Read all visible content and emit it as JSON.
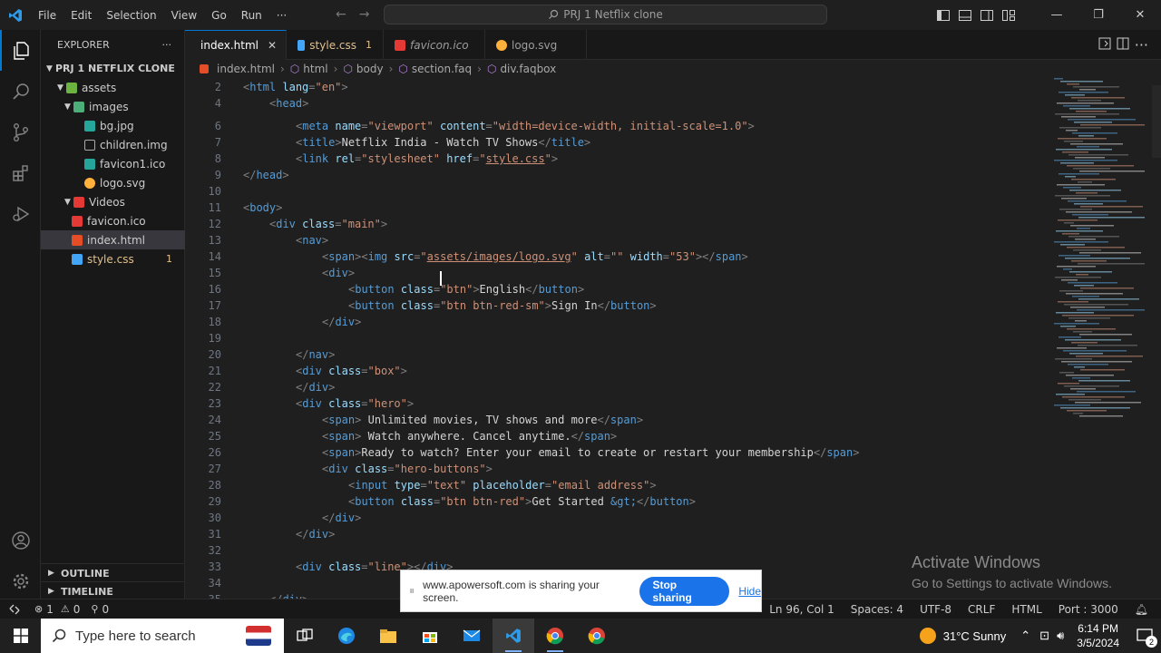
{
  "titlebar": {
    "menu": [
      "File",
      "Edit",
      "Selection",
      "View",
      "Go",
      "Run",
      "···"
    ],
    "search_text": "PRJ 1 Netflix clone"
  },
  "sidebar": {
    "title": "EXPLORER",
    "project": "PRJ 1 NETFLIX CLONE",
    "items": [
      {
        "label": "assets",
        "type": "folder"
      },
      {
        "label": "images",
        "type": "folder"
      },
      {
        "label": "bg.jpg",
        "type": "image"
      },
      {
        "label": "children.img",
        "type": "file"
      },
      {
        "label": "favicon1.ico",
        "type": "image"
      },
      {
        "label": "logo.svg",
        "type": "svg"
      },
      {
        "label": "Videos",
        "type": "folder"
      },
      {
        "label": "favicon.ico",
        "type": "ico"
      },
      {
        "label": "index.html",
        "type": "html"
      },
      {
        "label": "style.css",
        "type": "css",
        "badge": "1"
      }
    ],
    "outline": "OUTLINE",
    "timeline": "TIMELINE"
  },
  "tabs": [
    {
      "label": "index.html",
      "active": true
    },
    {
      "label": "style.css",
      "modified": "1"
    },
    {
      "label": "favicon.ico"
    },
    {
      "label": "logo.svg"
    }
  ],
  "breadcrumb": [
    "index.html",
    "html",
    "body",
    "section.faq",
    "div.faqbox"
  ],
  "editor": {
    "line_numbers": [
      "2",
      "4",
      "6",
      "7",
      "8",
      "9",
      "10",
      "11",
      "12",
      "13",
      "14",
      "15",
      "16",
      "17",
      "18",
      "19",
      "20",
      "21",
      "22",
      "23",
      "24",
      "25",
      "26",
      "27",
      "28",
      "29",
      "30",
      "31",
      "32",
      "33",
      "34",
      "35"
    ]
  },
  "statusbar": {
    "errors": "1",
    "warnings": "0",
    "ports": "0",
    "position": "Ln 96, Col 1",
    "spaces": "Spaces: 4",
    "encoding": "UTF-8",
    "eol": "CRLF",
    "language": "HTML",
    "port": "Port : 3000"
  },
  "share": {
    "message": "www.apowersoft.com is sharing your screen.",
    "stop": "Stop sharing",
    "hide": "Hide"
  },
  "watermark": {
    "title": "Activate Windows",
    "subtitle": "Go to Settings to activate Windows."
  },
  "taskbar": {
    "search_placeholder": "Type here to search",
    "weather": "31°C  Sunny",
    "time": "6:14 PM",
    "date": "3/5/2024",
    "notifications": "2"
  },
  "colors": {
    "accent": "#0078d4",
    "html_icon": "#e44d26",
    "css_icon": "#42a5f5",
    "modified": "#e2c08d"
  }
}
